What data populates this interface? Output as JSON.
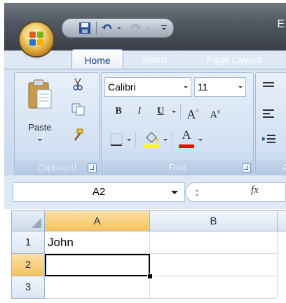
{
  "title_bar": {
    "partial_title": "E"
  },
  "tabs": [
    {
      "label": "Home",
      "active": true
    },
    {
      "label": "Insert",
      "active": false
    },
    {
      "label": "Page Layout",
      "active": false
    }
  ],
  "ribbon": {
    "clipboard": {
      "label": "Clipboard",
      "paste_label": "Paste"
    },
    "font": {
      "label": "Font",
      "font_name": "Calibri",
      "font_size": "11",
      "bold": "B",
      "italic": "I",
      "underline": "U",
      "grow": "A",
      "shrink": "A",
      "font_color_letter": "A",
      "highlight_color": "#ffff00",
      "font_color": "#ff0000"
    },
    "alignment": {
      "label": "A"
    }
  },
  "formula_bar": {
    "name_box": "A2",
    "fx": "fx",
    "formula": ""
  },
  "grid": {
    "columns": [
      "A",
      "B"
    ],
    "rows": [
      "1",
      "2",
      "3"
    ],
    "cells": [
      [
        "John",
        ""
      ],
      [
        "",
        ""
      ],
      [
        "",
        ""
      ]
    ],
    "selected_cell": "A2"
  },
  "colors": {
    "accent": "#15428b",
    "selected_header": "#f5c35e",
    "titlebar": "#4f565f"
  }
}
